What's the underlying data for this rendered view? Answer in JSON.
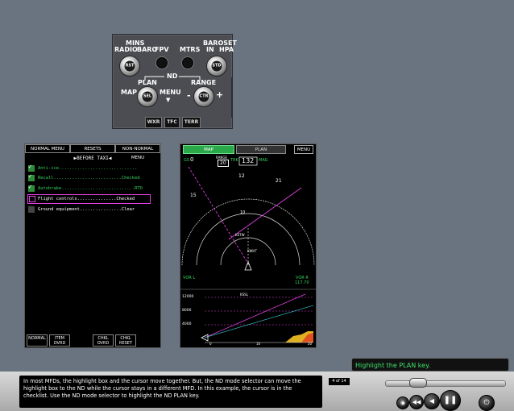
{
  "efis": {
    "mins_label": "MINS",
    "radio_label": "RADIO",
    "baro_label": "BARO",
    "rst_label": "RST",
    "fpv_label": "FPV",
    "mtrs_label": "MTRS",
    "baroset_label": "BAROSET",
    "in_label": "IN",
    "hpa_label": "HPA",
    "std_label": "STD",
    "nd_label": "ND",
    "plan_label": "PLAN",
    "map_label": "MAP",
    "sel_label": "SEL",
    "menu_label": "MENU",
    "range_label": "RANGE",
    "minus_label": "-",
    "plus_label": "+",
    "ctr_label": "CTR",
    "wxr_label": "WXR",
    "tfc_label": "TFC",
    "terr_label": "TERR"
  },
  "checklist": {
    "tabs": [
      "NORMAL MENU",
      "RESETS",
      "NON-NORMAL MENU"
    ],
    "title": "▶BEFORE TAXI◀",
    "items": [
      {
        "text": "Anti-ice..............................",
        "checked": true
      },
      {
        "text": "Recall..........................Checked",
        "checked": true
      },
      {
        "text": "Autobrake............................RTO",
        "checked": true
      },
      {
        "text": "Flight controls...............Checked",
        "checked": false
      },
      {
        "text": "Ground equipment................Clear",
        "checked": false
      }
    ],
    "footer": [
      "NORMAL",
      "ITEM\nOVRD",
      "CHKL\nOVRD",
      "CHKL\nRESET"
    ]
  },
  "nd": {
    "tabs": [
      "MAP",
      "PLAN",
      "MENU"
    ],
    "gs_label": "GS",
    "gs_value": "0",
    "range_label": "RANGE",
    "range_value": "20",
    "trk_label": "TRK",
    "heading": "132",
    "mag_label": "MAG",
    "compass": [
      "15",
      "12",
      "21"
    ],
    "ring_label": "10",
    "vor_l": "VOR L",
    "vor_r": "VOR R",
    "vor_r_freq": "117.70",
    "fix1": "KSTW",
    "fix2": "KWHT",
    "fix3": "KSSL",
    "alt_ticks": [
      "12000",
      "8000",
      "4000"
    ],
    "dist_ticks": [
      "0",
      "10",
      "20"
    ]
  },
  "hint": "Highlight the PLAN key.",
  "instruction": "In most MFDs, the highlight box and the cursor move together. But, the ND mode selector can move the highlight box to the ND while the cursor stays in a different MFD. In this example, the cursor is in the checklist. Use the ND mode selector to highlight the ND PLAN key.",
  "page": "4 of 14",
  "progress": 0.3,
  "colors": {
    "green": "#38d35c",
    "magenta": "#e040e0",
    "cyan": "#35d6e0",
    "background": "#6a7380"
  }
}
